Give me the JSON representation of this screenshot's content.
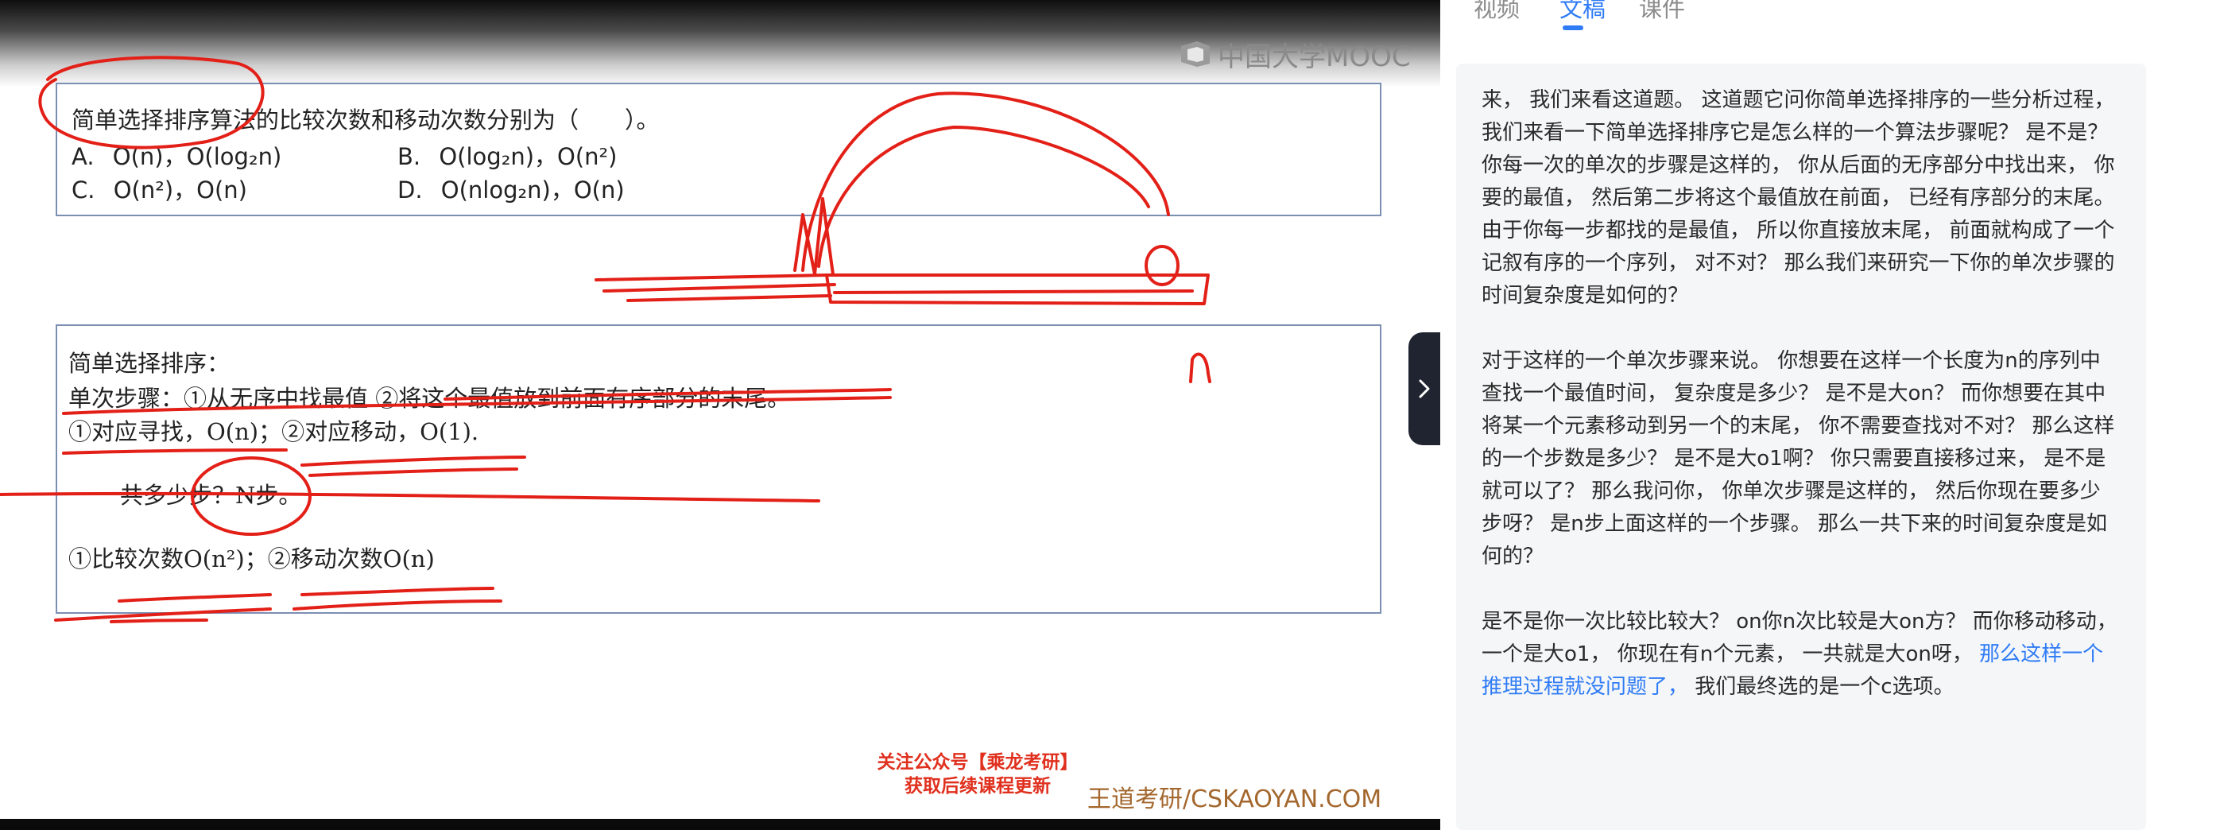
{
  "video": {
    "logo_text": "中国大学MOOC",
    "question1": {
      "stem": "简单选择排序算法的比较次数和移动次数分别为（　　）。",
      "options": [
        {
          "label": "A.",
          "text": "O(n)，O(log₂n)"
        },
        {
          "label": "B.",
          "text": "O(log₂n)，O(n²)"
        },
        {
          "label": "C.",
          "text": "O(n²)，O(n)"
        },
        {
          "label": "D.",
          "text": "O(nlog₂n)，O(n)"
        }
      ]
    },
    "analysis": {
      "title": "简单选择排序：",
      "step": "单次步骤：①从无序中找最值 ②将这个最值放到前面有序部分的末尾。",
      "cost": "①对应寻找，O(n)；②对应移动，O(1).",
      "count": "一共多少步？N步。",
      "result": "①比较次数O(n²)；②移动次数O(n)"
    },
    "promo_lines": [
      "关注公众号【乘龙考研】",
      "获取后续课程更新"
    ],
    "watermark": "王道考研/CSKAOYAN.COM",
    "ink_color": "#e32018"
  },
  "tabs": [
    {
      "label": "视频",
      "active": false
    },
    {
      "label": "文稿",
      "active": true
    },
    {
      "label": "课件",
      "active": false
    }
  ],
  "transcript": {
    "paragraphs": [
      {
        "text": "来，  我们来看这道题。  这道题它问你简单选择排序的一些分析过程，  我们来看一下简单选择排序它是怎么样的一个算法步骤呢？  是不是？  你每一次的单次的步骤是这样的，  你从后面的无序部分中找出来，  你要的最值，  然后第二步将这个最值放在前面，  已经有序部分的末尾。  由于你每一步都找的是最值，  所以你直接放末尾，  前面就构成了一个记叙有序的一个序列，  对不对？  那么我们来研究一下你的单次步骤的时间复杂度是如何的？",
        "highlight": ""
      },
      {
        "text": "对于这样的一个单次步骤来说。  你想要在这样一个长度为n的序列中查找一个最值时间，  复杂度是多少？  是不是大on？  而你想要在其中将某一个元素移动到另一个的末尾，  你不需要查找对不对？  那么这样的一个步数是多少？  是不是大o1啊？  你只需要直接移过来，  是不是就可以了？  那么我问你，  你单次步骤是这样的，  然后你现在要多少步呀？  是n步上面这样的一个步骤。  那么一共下来的时间复杂度是如何的？",
        "highlight": ""
      },
      {
        "text": "是不是你一次比较比较大？  on你n次比较是大on方？  而你移动移动，  一个是大o1，  你现在有n个元素，  一共就是大on呀，  ",
        "highlight": "那么这样一个推理过程就没问题了，",
        "tail": "  我们最终选的是一个c选项。"
      }
    ],
    "accent_color": "#2f7cf6"
  }
}
